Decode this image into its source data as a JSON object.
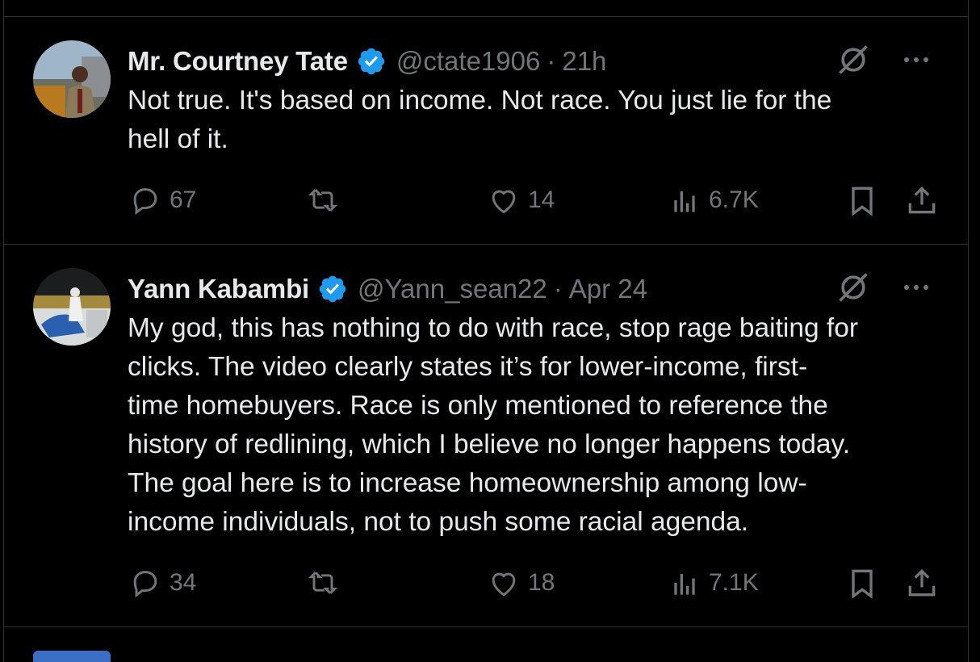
{
  "tweets": [
    {
      "name": "Mr. Courtney Tate",
      "handle": "@ctate1906",
      "separator": "·",
      "time": "21h",
      "text_lines": [
        "Not true. It's based on income. Not race. You just lie for the",
        "hell of it."
      ],
      "stats": {
        "replies": "67",
        "reposts": "",
        "likes": "14",
        "views": "6.7K"
      }
    },
    {
      "name": "Yann Kabambi",
      "handle": "@Yann_sean22",
      "separator": "·",
      "time": "Apr 24",
      "text_lines": [
        "My god, this has nothing to do with race, stop rage baiting for",
        "clicks. The video clearly states it’s for lower-income, first-",
        "time homebuyers. Race is only mentioned to reference the",
        "history of redlining, which I believe no longer happens today.",
        "The goal here is to increase homeownership among low-",
        "income individuals, not to push some racial agenda."
      ],
      "stats": {
        "replies": "34",
        "reposts": "",
        "likes": "18",
        "views": "7.1K"
      }
    }
  ],
  "colors": {
    "background": "#000000",
    "text": "#e7e9ea",
    "muted": "#71767b",
    "border": "#2f3336",
    "verified": "#1d9bf0"
  },
  "icons": [
    "verified-badge-icon",
    "grok-icon",
    "more-icon",
    "reply-icon",
    "repost-icon",
    "like-icon",
    "views-icon",
    "bookmark-icon",
    "share-icon"
  ]
}
